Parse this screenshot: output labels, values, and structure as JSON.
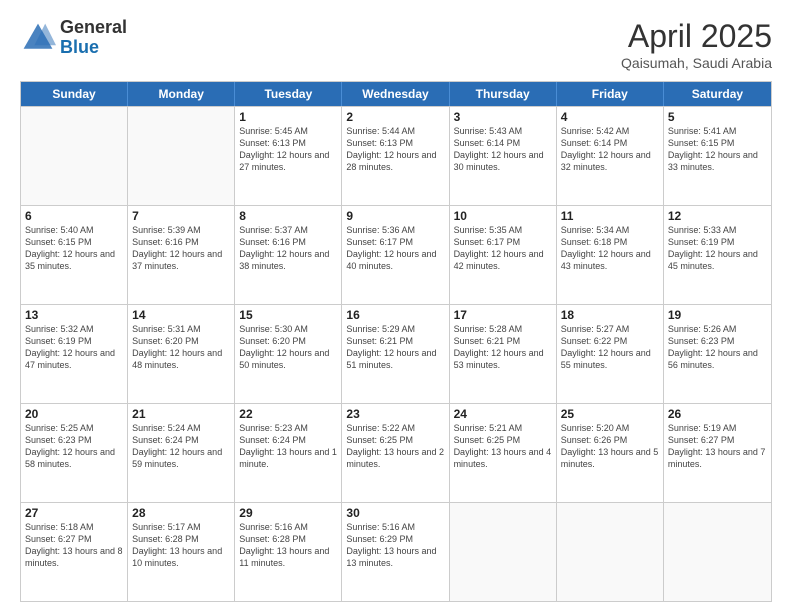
{
  "header": {
    "logo_general": "General",
    "logo_blue": "Blue",
    "title": "April 2025",
    "location": "Qaisumah, Saudi Arabia"
  },
  "days_of_week": [
    "Sunday",
    "Monday",
    "Tuesday",
    "Wednesday",
    "Thursday",
    "Friday",
    "Saturday"
  ],
  "weeks": [
    [
      {
        "day": "",
        "sunrise": "",
        "sunset": "",
        "daylight": ""
      },
      {
        "day": "",
        "sunrise": "",
        "sunset": "",
        "daylight": ""
      },
      {
        "day": "1",
        "sunrise": "Sunrise: 5:45 AM",
        "sunset": "Sunset: 6:13 PM",
        "daylight": "Daylight: 12 hours and 27 minutes."
      },
      {
        "day": "2",
        "sunrise": "Sunrise: 5:44 AM",
        "sunset": "Sunset: 6:13 PM",
        "daylight": "Daylight: 12 hours and 28 minutes."
      },
      {
        "day": "3",
        "sunrise": "Sunrise: 5:43 AM",
        "sunset": "Sunset: 6:14 PM",
        "daylight": "Daylight: 12 hours and 30 minutes."
      },
      {
        "day": "4",
        "sunrise": "Sunrise: 5:42 AM",
        "sunset": "Sunset: 6:14 PM",
        "daylight": "Daylight: 12 hours and 32 minutes."
      },
      {
        "day": "5",
        "sunrise": "Sunrise: 5:41 AM",
        "sunset": "Sunset: 6:15 PM",
        "daylight": "Daylight: 12 hours and 33 minutes."
      }
    ],
    [
      {
        "day": "6",
        "sunrise": "Sunrise: 5:40 AM",
        "sunset": "Sunset: 6:15 PM",
        "daylight": "Daylight: 12 hours and 35 minutes."
      },
      {
        "day": "7",
        "sunrise": "Sunrise: 5:39 AM",
        "sunset": "Sunset: 6:16 PM",
        "daylight": "Daylight: 12 hours and 37 minutes."
      },
      {
        "day": "8",
        "sunrise": "Sunrise: 5:37 AM",
        "sunset": "Sunset: 6:16 PM",
        "daylight": "Daylight: 12 hours and 38 minutes."
      },
      {
        "day": "9",
        "sunrise": "Sunrise: 5:36 AM",
        "sunset": "Sunset: 6:17 PM",
        "daylight": "Daylight: 12 hours and 40 minutes."
      },
      {
        "day": "10",
        "sunrise": "Sunrise: 5:35 AM",
        "sunset": "Sunset: 6:17 PM",
        "daylight": "Daylight: 12 hours and 42 minutes."
      },
      {
        "day": "11",
        "sunrise": "Sunrise: 5:34 AM",
        "sunset": "Sunset: 6:18 PM",
        "daylight": "Daylight: 12 hours and 43 minutes."
      },
      {
        "day": "12",
        "sunrise": "Sunrise: 5:33 AM",
        "sunset": "Sunset: 6:19 PM",
        "daylight": "Daylight: 12 hours and 45 minutes."
      }
    ],
    [
      {
        "day": "13",
        "sunrise": "Sunrise: 5:32 AM",
        "sunset": "Sunset: 6:19 PM",
        "daylight": "Daylight: 12 hours and 47 minutes."
      },
      {
        "day": "14",
        "sunrise": "Sunrise: 5:31 AM",
        "sunset": "Sunset: 6:20 PM",
        "daylight": "Daylight: 12 hours and 48 minutes."
      },
      {
        "day": "15",
        "sunrise": "Sunrise: 5:30 AM",
        "sunset": "Sunset: 6:20 PM",
        "daylight": "Daylight: 12 hours and 50 minutes."
      },
      {
        "day": "16",
        "sunrise": "Sunrise: 5:29 AM",
        "sunset": "Sunset: 6:21 PM",
        "daylight": "Daylight: 12 hours and 51 minutes."
      },
      {
        "day": "17",
        "sunrise": "Sunrise: 5:28 AM",
        "sunset": "Sunset: 6:21 PM",
        "daylight": "Daylight: 12 hours and 53 minutes."
      },
      {
        "day": "18",
        "sunrise": "Sunrise: 5:27 AM",
        "sunset": "Sunset: 6:22 PM",
        "daylight": "Daylight: 12 hours and 55 minutes."
      },
      {
        "day": "19",
        "sunrise": "Sunrise: 5:26 AM",
        "sunset": "Sunset: 6:23 PM",
        "daylight": "Daylight: 12 hours and 56 minutes."
      }
    ],
    [
      {
        "day": "20",
        "sunrise": "Sunrise: 5:25 AM",
        "sunset": "Sunset: 6:23 PM",
        "daylight": "Daylight: 12 hours and 58 minutes."
      },
      {
        "day": "21",
        "sunrise": "Sunrise: 5:24 AM",
        "sunset": "Sunset: 6:24 PM",
        "daylight": "Daylight: 12 hours and 59 minutes."
      },
      {
        "day": "22",
        "sunrise": "Sunrise: 5:23 AM",
        "sunset": "Sunset: 6:24 PM",
        "daylight": "Daylight: 13 hours and 1 minute."
      },
      {
        "day": "23",
        "sunrise": "Sunrise: 5:22 AM",
        "sunset": "Sunset: 6:25 PM",
        "daylight": "Daylight: 13 hours and 2 minutes."
      },
      {
        "day": "24",
        "sunrise": "Sunrise: 5:21 AM",
        "sunset": "Sunset: 6:25 PM",
        "daylight": "Daylight: 13 hours and 4 minutes."
      },
      {
        "day": "25",
        "sunrise": "Sunrise: 5:20 AM",
        "sunset": "Sunset: 6:26 PM",
        "daylight": "Daylight: 13 hours and 5 minutes."
      },
      {
        "day": "26",
        "sunrise": "Sunrise: 5:19 AM",
        "sunset": "Sunset: 6:27 PM",
        "daylight": "Daylight: 13 hours and 7 minutes."
      }
    ],
    [
      {
        "day": "27",
        "sunrise": "Sunrise: 5:18 AM",
        "sunset": "Sunset: 6:27 PM",
        "daylight": "Daylight: 13 hours and 8 minutes."
      },
      {
        "day": "28",
        "sunrise": "Sunrise: 5:17 AM",
        "sunset": "Sunset: 6:28 PM",
        "daylight": "Daylight: 13 hours and 10 minutes."
      },
      {
        "day": "29",
        "sunrise": "Sunrise: 5:16 AM",
        "sunset": "Sunset: 6:28 PM",
        "daylight": "Daylight: 13 hours and 11 minutes."
      },
      {
        "day": "30",
        "sunrise": "Sunrise: 5:16 AM",
        "sunset": "Sunset: 6:29 PM",
        "daylight": "Daylight: 13 hours and 13 minutes."
      },
      {
        "day": "",
        "sunrise": "",
        "sunset": "",
        "daylight": ""
      },
      {
        "day": "",
        "sunrise": "",
        "sunset": "",
        "daylight": ""
      },
      {
        "day": "",
        "sunrise": "",
        "sunset": "",
        "daylight": ""
      }
    ]
  ]
}
